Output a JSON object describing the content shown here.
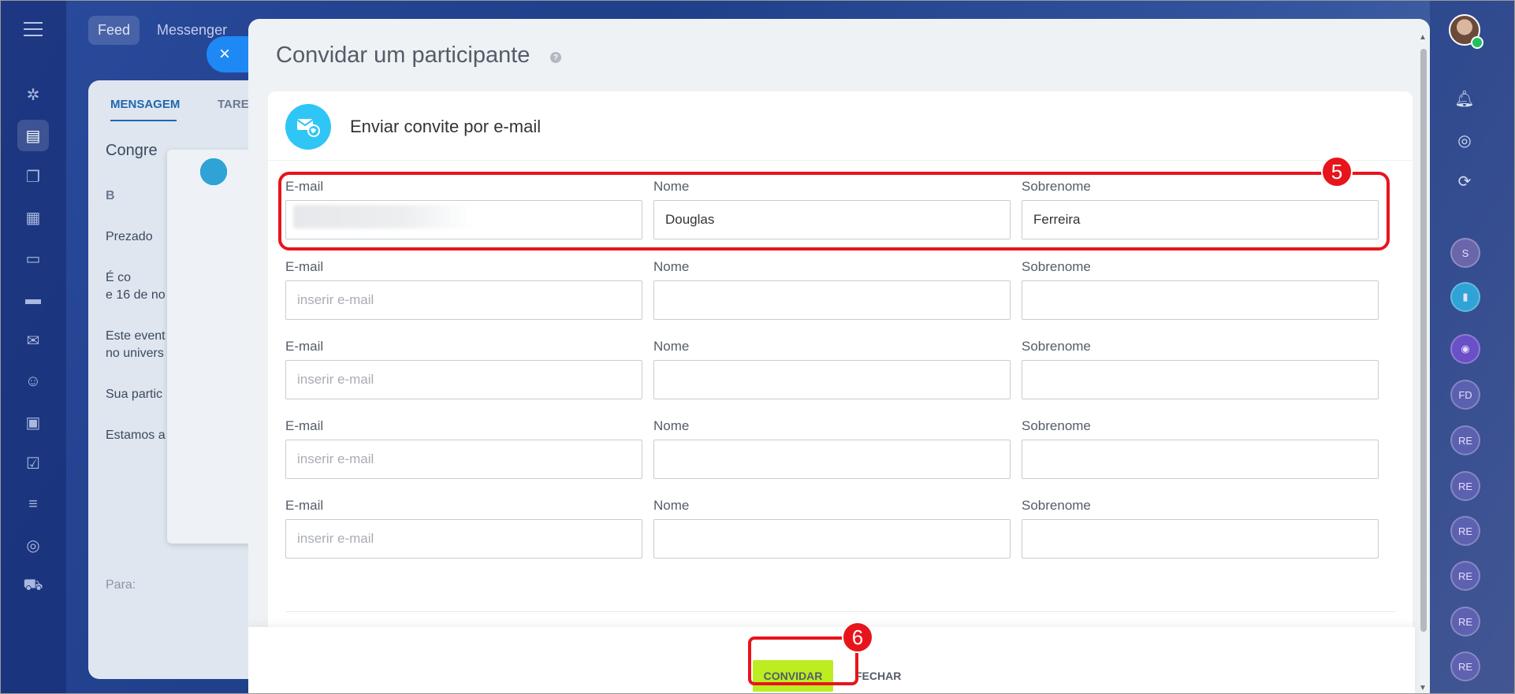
{
  "background": {
    "top_tabs": [
      "Feed",
      "Messenger"
    ],
    "panel_tabs": [
      "MENSAGEM",
      "TAREF"
    ],
    "panel_texts": [
      "Congre",
      "B",
      "Prezado",
      "É co",
      "e 16 de no",
      "Este event",
      "no univers",
      "Sua partic",
      "Estamos a",
      "Para:"
    ],
    "left_nav_icons": [
      "menu-icon",
      "puzzle-icon",
      "feed-icon",
      "chat-icon",
      "calendar-icon",
      "document-icon",
      "car-icon",
      "mail-icon",
      "contacts-icon",
      "presentation-icon",
      "tasks-icon",
      "filter-icon",
      "target-icon",
      "cart-icon"
    ]
  },
  "right_rail": {
    "status": "online",
    "circles": [
      "S",
      "",
      "",
      "FD",
      "RE",
      "RE",
      "RE",
      "RE",
      "RE",
      "RE"
    ]
  },
  "modal": {
    "title": "Convidar um participante",
    "help_icon": "?",
    "close_icon": "×",
    "section_title": "Enviar convite por e-mail",
    "rows": [
      {
        "email_label": "E-mail",
        "email_value": "",
        "email_placeholder": "",
        "name_label": "Nome",
        "name_value": "Douglas",
        "surname_label": "Sobrenome",
        "surname_value": "Ferreira"
      },
      {
        "email_label": "E-mail",
        "email_value": "",
        "email_placeholder": "inserir e-mail",
        "name_label": "Nome",
        "name_value": "",
        "surname_label": "Sobrenome",
        "surname_value": ""
      },
      {
        "email_label": "E-mail",
        "email_value": "",
        "email_placeholder": "inserir e-mail",
        "name_label": "Nome",
        "name_value": "",
        "surname_label": "Sobrenome",
        "surname_value": ""
      },
      {
        "email_label": "E-mail",
        "email_value": "",
        "email_placeholder": "inserir e-mail",
        "name_label": "Nome",
        "name_value": "",
        "surname_label": "Sobrenome",
        "surname_value": ""
      },
      {
        "email_label": "E-mail",
        "email_value": "",
        "email_placeholder": "inserir e-mail",
        "name_label": "Nome",
        "name_value": "",
        "surname_label": "Sobrenome",
        "surname_value": ""
      }
    ],
    "invite_button": "CONVIDAR",
    "close_button": "FECHAR"
  },
  "annotations": {
    "step_5": "5",
    "step_6": "6"
  },
  "colors": {
    "accent_green": "#bbed21",
    "highlight_red": "#e8141c",
    "mail_icon_blue": "#2fc6f6"
  }
}
